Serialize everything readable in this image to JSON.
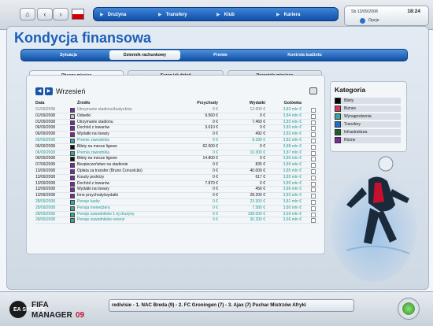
{
  "topbar": {
    "nav": {
      "home": "⌂",
      "back": "‹",
      "forward": "›"
    },
    "menu": [
      "Drużyna",
      "Transfery",
      "Klub",
      "Kariera"
    ],
    "date": "Sb 13/09/2008",
    "time": "18:24",
    "options_label": "Opcje"
  },
  "page": {
    "title": "Kondycja finansowa"
  },
  "tabs": [
    "Sytuacja",
    "Dziennik rachunkowy",
    "Premie",
    "Kontrola budżetu"
  ],
  "subtabs": [
    "Obecny miesiąc",
    "Sezon jak dotąd",
    "Pozostałe miesiące"
  ],
  "month": {
    "label": "Wrzesień",
    "prev": "◀",
    "next": "▶"
  },
  "table": {
    "headers": [
      "Data",
      "Źródło",
      "Przychody",
      "Wydatki",
      "Gotówka"
    ],
    "rows": [
      {
        "date": "01/09/2008",
        "src": "Utrzymanie stadionu/budynków",
        "inc": "0 €",
        "exp": "12.600 €",
        "cash": "3,83 mln €",
        "style": "grey",
        "color": "#7a2aa0"
      },
      {
        "date": "01/09/2008",
        "src": "Odsetki",
        "inc": "9.560 €",
        "exp": "0 €",
        "cash": "3,84 mln €",
        "style": "dark",
        "color": "#c0c0c0"
      },
      {
        "date": "01/09/2008",
        "src": "Utrzymanie stadionu",
        "inc": "0 €",
        "exp": "7.460 €",
        "cash": "3,83 mln €",
        "style": "dark",
        "color": "#7a2aa0"
      },
      {
        "date": "06/09/2008",
        "src": "Dochód z towarów",
        "inc": "3.610 €",
        "exp": "0 €",
        "cash": "3,83 mln €",
        "style": "dark",
        "color": "#7a2aa0"
      },
      {
        "date": "06/09/2008",
        "src": "Wydatki na towary",
        "inc": "0 €",
        "exp": "492 €",
        "cash": "3,83 mln €",
        "style": "dark",
        "color": "#7a2aa0"
      },
      {
        "date": "06/09/2008",
        "src": "Premie zawodnika",
        "inc": "0 €",
        "exp": "8.390 €",
        "cash": "3,82 mln €",
        "style": "teal",
        "color": "#3aa69a"
      },
      {
        "date": "06/09/2008",
        "src": "Bilety na mecze ligowe",
        "inc": "62.600 €",
        "exp": "0 €",
        "cash": "3,88 mln €",
        "style": "dark",
        "color": "#111111"
      },
      {
        "date": "06/09/2008",
        "src": "Premia zawodnika",
        "inc": "0 €",
        "exp": "10.300 €",
        "cash": "3,87 mln €",
        "style": "teal",
        "color": "#3aa69a"
      },
      {
        "date": "06/09/2008",
        "src": "Bilety na mecze ligowe",
        "inc": "14.800 €",
        "exp": "0 €",
        "cash": "3,89 mln €",
        "style": "dark",
        "color": "#111111"
      },
      {
        "date": "07/09/2008",
        "src": "Bezpieczeństwo na stadionie",
        "inc": "0 €",
        "exp": "835 €",
        "cash": "3,89 mln €",
        "style": "dark",
        "color": "#7a2aa0"
      },
      {
        "date": "13/09/2008",
        "src": "Opłata za transfer (Bruno Concelcão)",
        "inc": "0 €",
        "exp": "40.000 €",
        "cash": "3,85 mln €",
        "style": "dark",
        "color": "#7a2aa0"
      },
      {
        "date": "13/09/2008",
        "src": "Koszty podróży",
        "inc": "0 €",
        "exp": "617 €",
        "cash": "3,85 mln €",
        "style": "dark",
        "color": "#7a2aa0"
      },
      {
        "date": "13/09/2008",
        "src": "Dochód z towarów",
        "inc": "7.870 €",
        "exp": "0 €",
        "cash": "3,85 mln €",
        "style": "dark",
        "color": "#7a2aa0"
      },
      {
        "date": "13/09/2008",
        "src": "Wydatki na towary",
        "inc": "0 €",
        "exp": "456 €",
        "cash": "3,86 mln €",
        "style": "dark",
        "color": "#7a2aa0"
      },
      {
        "date": "13/09/2008",
        "src": "Inne przychody/wydatki",
        "inc": "0 €",
        "exp": "28.200 €",
        "cash": "3,83 mln €",
        "style": "dark",
        "color": "#7a2aa0"
      },
      {
        "date": "28/09/2008",
        "src": "Pensje kadry",
        "inc": "0 €",
        "exp": "23.300 €",
        "cash": "3,81 mln €",
        "style": "teal",
        "color": "#3aa69a"
      },
      {
        "date": "28/09/2008",
        "src": "Pensja menedżera",
        "inc": "0 €",
        "exp": "7.580 €",
        "cash": "3,80 mln €",
        "style": "teal",
        "color": "#3aa69a"
      },
      {
        "date": "28/09/2008",
        "src": "Pensje zawodników 1-ej drużyny",
        "inc": "0 €",
        "exp": "108.000 €",
        "cash": "3,69 mln €",
        "style": "teal",
        "color": "#3aa69a"
      },
      {
        "date": "28/09/2008",
        "src": "Pensje zawodników rezerw",
        "inc": "0 €",
        "exp": "30.200 €",
        "cash": "3,66 mln €",
        "style": "teal",
        "color": "#3aa69a"
      }
    ]
  },
  "categories": {
    "title": "Kategoria",
    "items": [
      {
        "label": "Bilety",
        "color": "#000000"
      },
      {
        "label": "Biznes",
        "color": "#d9365d"
      },
      {
        "label": "Wynagrodzenia",
        "color": "#3aa69a"
      },
      {
        "label": "Transfery",
        "color": "#1e6fd0"
      },
      {
        "label": "Infrastruktura",
        "color": "#1f5f2c"
      },
      {
        "label": "Różne",
        "color": "#7a2aa0"
      }
    ]
  },
  "bottombar": {
    "ticker": "redivisie - 1. NAC Breda (9) - 2. FC Groningen (7) - 3. Ajax (7)      Puchar Mistrzów Afryki",
    "logo_ea": "EA SPORTS",
    "logo_fifa": "FIFA",
    "logo_manager": "MANAGER",
    "logo_year": "09"
  }
}
